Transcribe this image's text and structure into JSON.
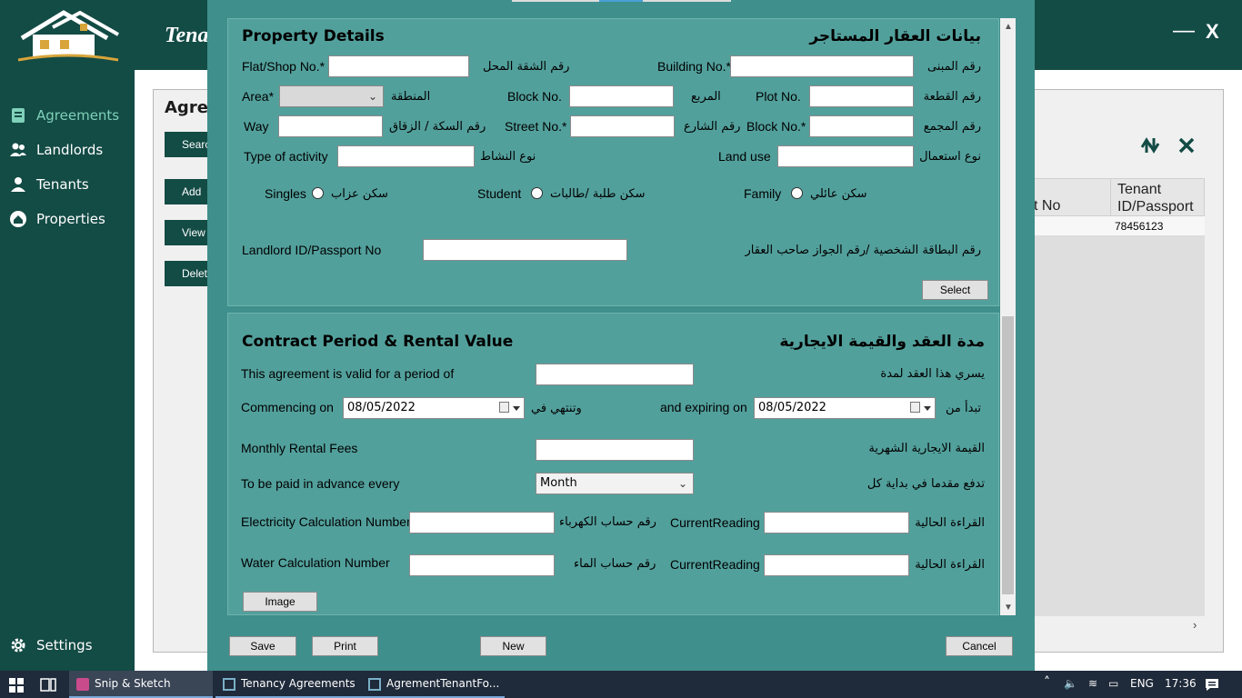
{
  "app": {
    "title": "Tenancy Agreements",
    "close_label": "X",
    "minimize_label": "—"
  },
  "sidebar": {
    "items": [
      {
        "label": "Agreements",
        "icon": "agreement-icon"
      },
      {
        "label": "Landlords",
        "icon": "users-icon"
      },
      {
        "label": "Tenants",
        "icon": "user-icon"
      },
      {
        "label": "Properties",
        "icon": "properties-icon"
      }
    ],
    "settings_label": "Settings"
  },
  "main": {
    "title": "Agree",
    "buttons": [
      "Search",
      "Add",
      "View",
      "Delete"
    ],
    "grid": {
      "col_partial": "t No",
      "col_tenant": "Tenant ID/Passport N",
      "row_value": "78456123"
    }
  },
  "property": {
    "title_en": "Property Details",
    "title_ar": "بيانات العقار المستاجر",
    "flat_en": "Flat/Shop No.*",
    "flat_ar": "رقم الشقة المحل",
    "building_en": "Building No.*",
    "building_ar": "رقم المبنى",
    "area_en": "Area*",
    "area_ar": "المنطقة",
    "block_en": "Block No.",
    "block_ar": "المربع",
    "plot_en": "Plot No.",
    "plot_ar": "رقم القطعة",
    "way_en": "Way",
    "way_ar": "رقم السكة / الزقاق",
    "street_en": "Street No.*",
    "street_ar": "رقم الشارع",
    "block2_en": "Block No.*",
    "block2_ar": "رقم المجمع",
    "activity_en": "Type of activity",
    "activity_ar": "نوع النشاط",
    "landuse_en": "Land use",
    "landuse_ar": "نوع استعمال",
    "singles_en": "Singles",
    "singles_ar": "سكن عزاب",
    "student_en": "Student",
    "student_ar": "سكن طلبة /طالبات",
    "family_en": "Family",
    "family_ar": "سكن عائلي",
    "landlord_en": "Landlord ID/Passport No",
    "landlord_ar": "رقم البطاقة الشخصية /رقم الجواز  صاحب العقار",
    "select_label": "Select"
  },
  "contract": {
    "title_en": "Contract Period & Rental Value",
    "title_ar": "مدة العقد والقيمة الايجارية",
    "period_en": "This agreement is valid for a period of",
    "period_ar": "يسري هذا العقد لمدة",
    "commencing_en": "Commencing on",
    "commencing_value": "08/05/2022",
    "commencing_ar": "وتنتهي في",
    "expiring_en": "and expiring on",
    "expiring_value": "08/05/2022",
    "expiring_ar": "تبدأ من",
    "rental_en": "Monthly Rental Fees",
    "rental_ar": "القيمة الايجارية الشهرية",
    "advance_en": "To be paid in advance every",
    "advance_value": "Month",
    "advance_ar": "تدفع مقدما في بداية كل",
    "elec_en": "Electricity Calculation Number",
    "elec_ar": "رقم حساب الكهرباء",
    "reading_en": "CurrentReading",
    "reading_ar": "القراءة الحالية",
    "water_en": "Water Calculation Number",
    "water_ar": "رقم حساب الماء",
    "image_label": "Image"
  },
  "footer": {
    "save": "Save",
    "print": "Print",
    "new": "New",
    "cancel": "Cancel"
  },
  "taskbar": {
    "items": [
      "Snip & Sketch",
      "Tenancy Agreements",
      "AgrementTenantFo..."
    ],
    "lang": "ENG",
    "time": "17:36"
  },
  "colors": {
    "brand": "#134b45",
    "dialog": "#3f8f8c",
    "section": "#52a09c",
    "accent": "#7fd1b9"
  }
}
